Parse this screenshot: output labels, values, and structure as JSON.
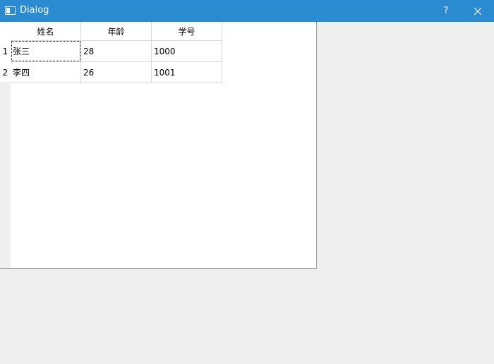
{
  "window": {
    "title": "Dialog",
    "help_label": "?",
    "close_icon": "close-icon"
  },
  "table": {
    "columns": [
      "姓名",
      "年龄",
      "学号"
    ],
    "rows": [
      {
        "header": "1",
        "cells": [
          "张三",
          "28",
          "1000"
        ]
      },
      {
        "header": "2",
        "cells": [
          "李四",
          "26",
          "1001"
        ]
      }
    ]
  }
}
